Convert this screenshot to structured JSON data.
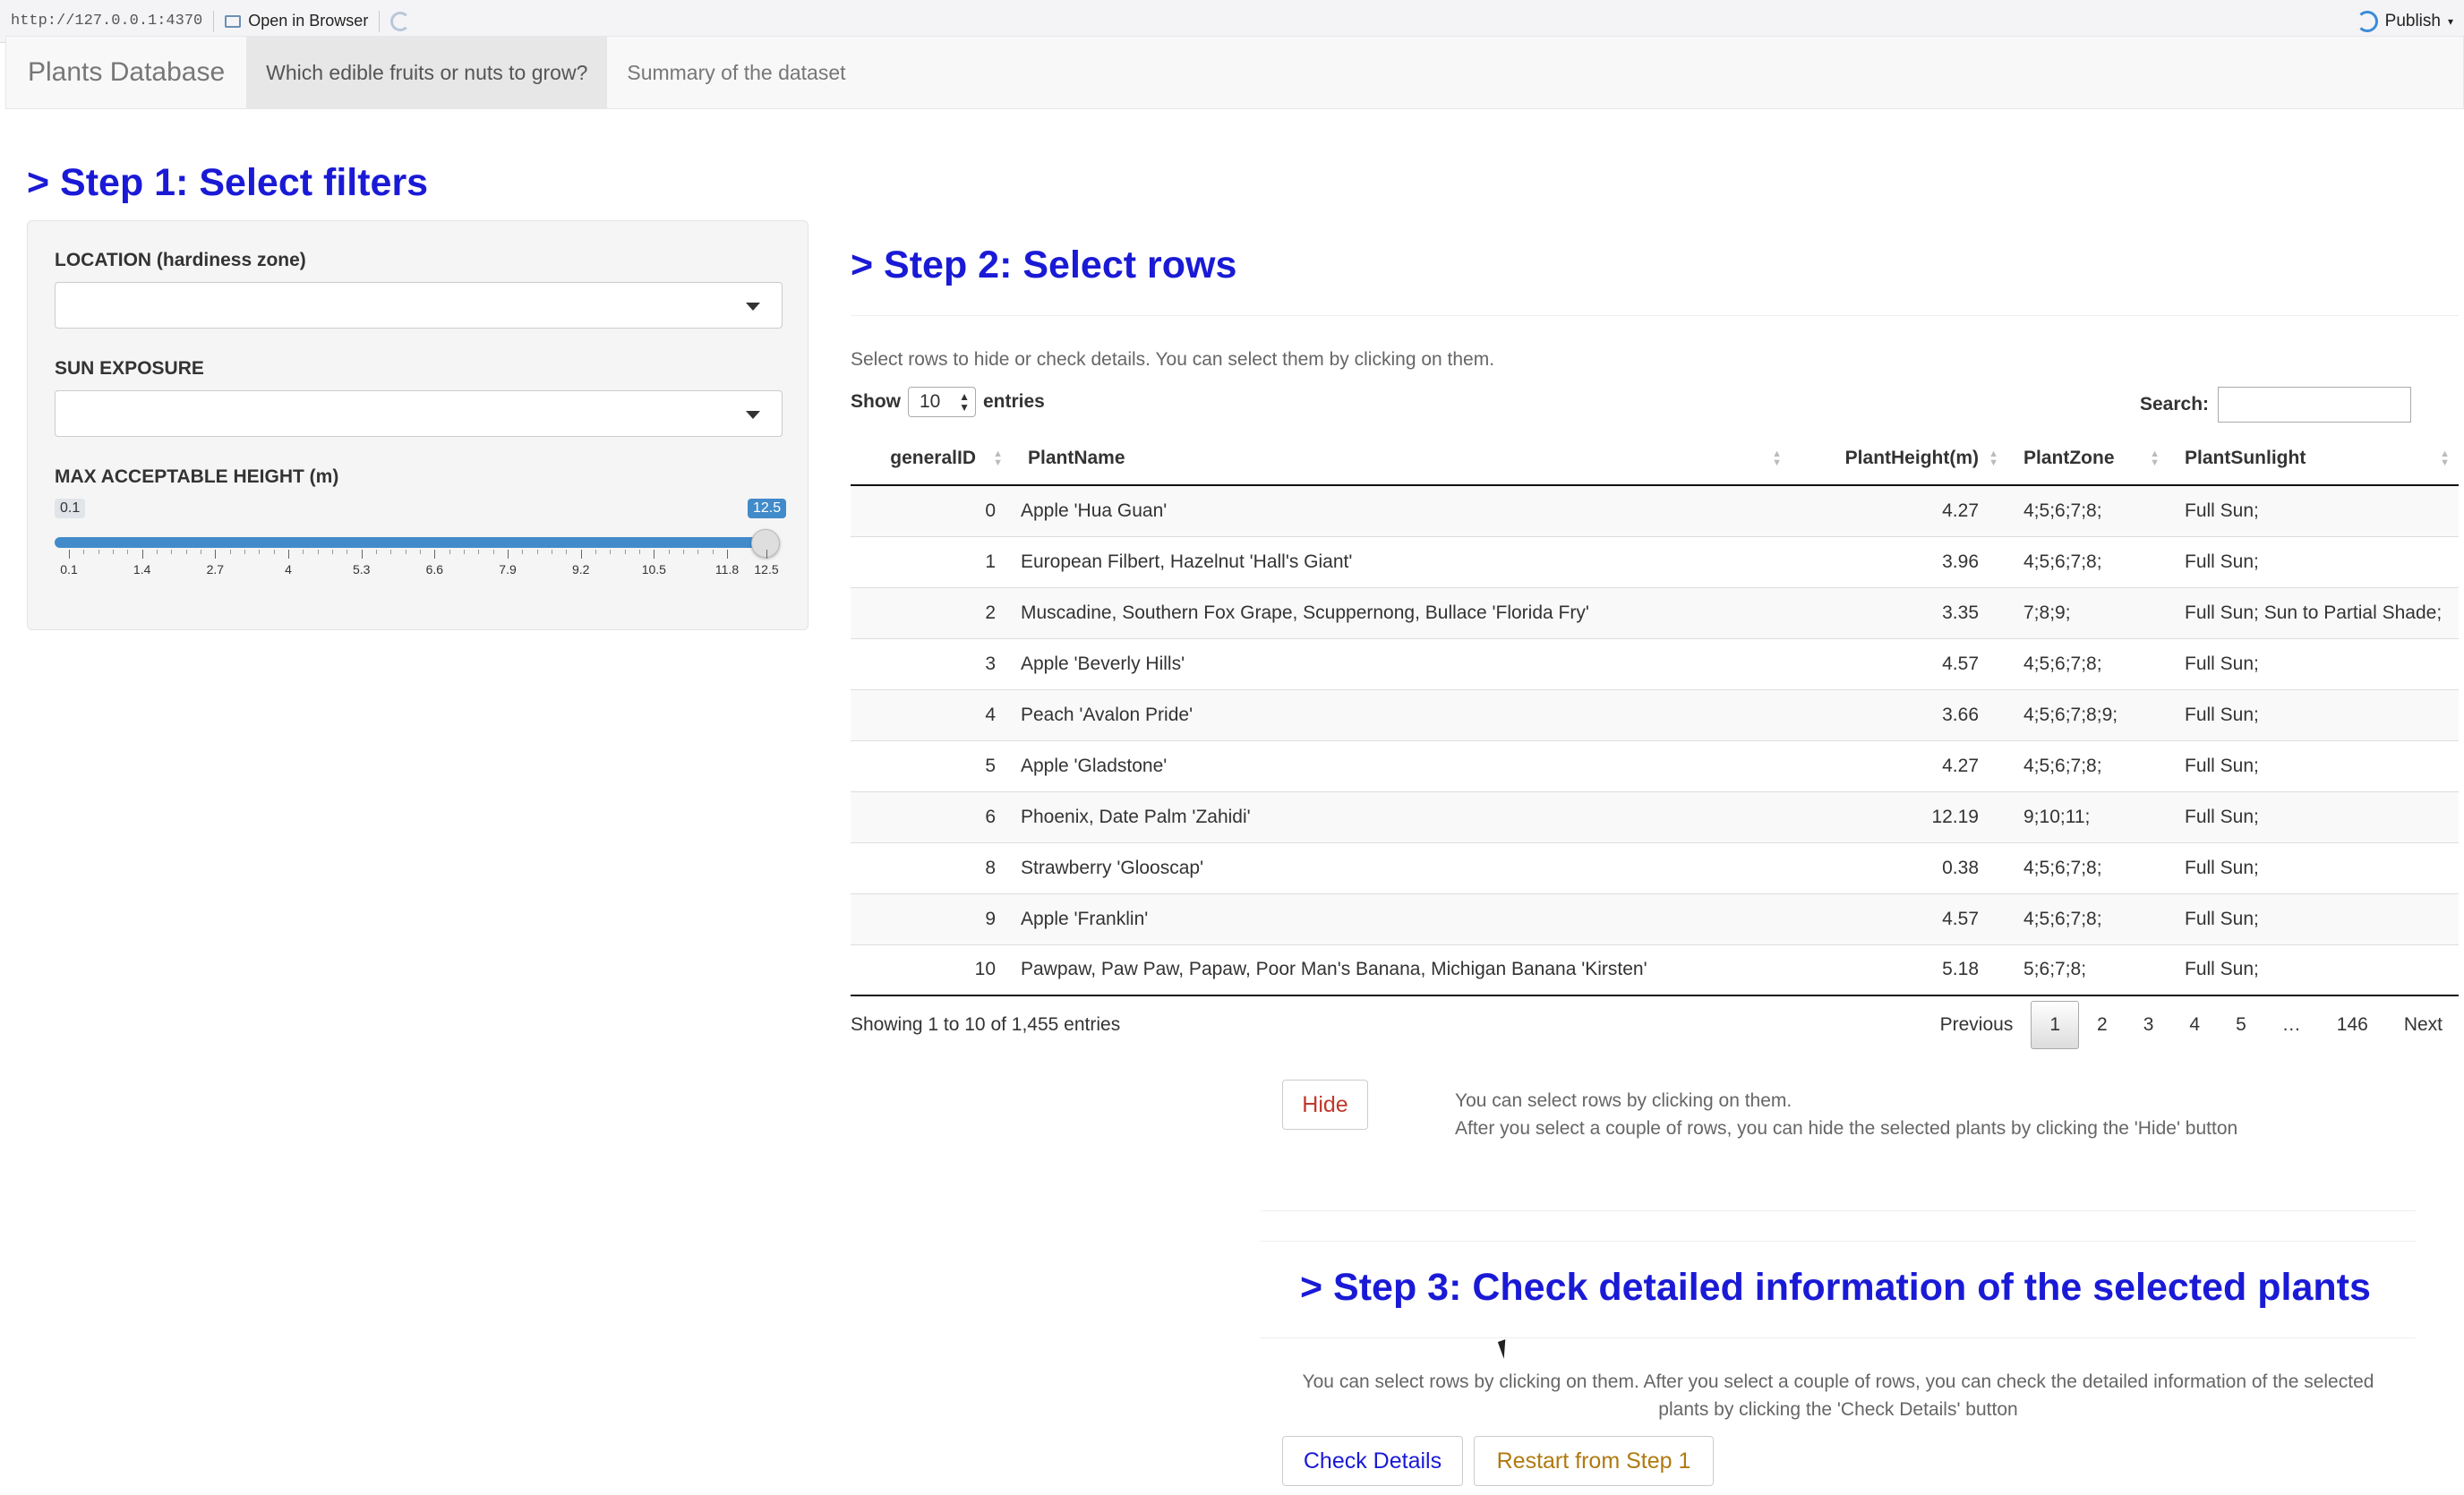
{
  "viewer": {
    "url": "http://127.0.0.1:4370",
    "open_in_browser": "Open in Browser",
    "publish": "Publish"
  },
  "navbar": {
    "brand": "Plants Database",
    "tabs": [
      "Which edible fruits or nuts to grow?",
      "Summary of the dataset"
    ],
    "active_tab": 0
  },
  "step1": {
    "title": "> Step 1: Select filters",
    "location_label": "LOCATION (hardiness zone)",
    "location_value": "",
    "sun_label": "SUN EXPOSURE",
    "sun_value": "",
    "height_label": "MAX ACCEPTABLE HEIGHT (m)",
    "slider": {
      "min": 0.1,
      "max": 12.5,
      "selected_min": 0.1,
      "selected_max": 12.5,
      "min_badge": "0.1",
      "max_badge": "12.5",
      "tick_labels": [
        "0.1",
        "1.4",
        "2.7",
        "4",
        "5.3",
        "6.6",
        "7.9",
        "9.2",
        "10.5",
        "11.8",
        "12.5"
      ]
    }
  },
  "step2": {
    "title": "> Step 2: Select rows",
    "description": "Select rows to hide or check details. You can select them by clicking on them.",
    "show_label": "Show",
    "entries_label": "entries",
    "page_length": "10",
    "search_label": "Search:",
    "search_value": "",
    "columns": [
      "generalID",
      "PlantName",
      "PlantHeight(m)",
      "PlantZone",
      "PlantSunlight"
    ],
    "rows": [
      [
        "0",
        "Apple 'Hua Guan'",
        "4.27",
        "4;5;6;7;8;",
        "Full Sun;"
      ],
      [
        "1",
        "European Filbert, Hazelnut 'Hall's Giant'",
        "3.96",
        "4;5;6;7;8;",
        "Full Sun;"
      ],
      [
        "2",
        "Muscadine, Southern Fox Grape, Scuppernong, Bullace 'Florida Fry'",
        "3.35",
        "7;8;9;",
        "Full Sun; Sun to Partial Shade;"
      ],
      [
        "3",
        "Apple 'Beverly Hills'",
        "4.57",
        "4;5;6;7;8;",
        "Full Sun;"
      ],
      [
        "4",
        "Peach 'Avalon Pride'",
        "3.66",
        "4;5;6;7;8;9;",
        "Full Sun;"
      ],
      [
        "5",
        "Apple 'Gladstone'",
        "4.27",
        "4;5;6;7;8;",
        "Full Sun;"
      ],
      [
        "6",
        "Phoenix, Date Palm 'Zahidi'",
        "12.19",
        "9;10;11;",
        "Full Sun;"
      ],
      [
        "8",
        "Strawberry 'Glooscap'",
        "0.38",
        "4;5;6;7;8;",
        "Full Sun;"
      ],
      [
        "9",
        "Apple 'Franklin'",
        "4.57",
        "4;5;6;7;8;",
        "Full Sun;"
      ],
      [
        "10",
        "Pawpaw, Paw Paw, Papaw, Poor Man's Banana, Michigan Banana 'Kirsten'",
        "5.18",
        "5;6;7;8;",
        "Full Sun;"
      ]
    ],
    "info": "Showing 1 to 10 of 1,455 entries",
    "pagination": {
      "previous": "Previous",
      "pages": [
        "1",
        "2",
        "3",
        "4",
        "5",
        "…",
        "146"
      ],
      "current": "1",
      "next": "Next"
    },
    "hide_button": "Hide",
    "hide_note_1": "You can select rows by clicking on them.",
    "hide_note_2": "After you select a couple of rows, you can hide the selected plants by clicking the 'Hide' button"
  },
  "step3": {
    "title": "> Step 3: Check detailed information of the selected plants",
    "note_1": "You can select rows by clicking on them. After you select a couple of rows, you can check the detailed information of the selected",
    "note_2": "plants by clicking the 'Check Details' button",
    "check_button": "Check Details",
    "restart_button": "Restart from Step 1"
  },
  "colors": {
    "heading": "#1a1ad6",
    "slider": "#428bca",
    "hide_button_text": "#c0392b",
    "check_button_text": "#1a1ad6",
    "restart_button_text": "#b07a10"
  }
}
